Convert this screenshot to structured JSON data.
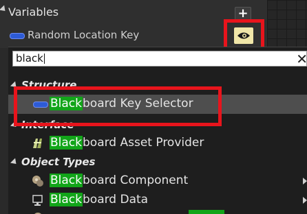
{
  "variables": {
    "title": "Variables",
    "add_label": "+",
    "variable_name": "Random Location Key"
  },
  "picker": {
    "search_value": "black",
    "categories": [
      {
        "label": "Structure"
      },
      {
        "label": "Interface"
      },
      {
        "label": "Object Types"
      }
    ],
    "items": [
      {
        "match": "Black",
        "rest": "board Key Selector",
        "category": "Structure",
        "selected": true
      },
      {
        "match": "Black",
        "rest": "board Asset Provider",
        "category": "Interface"
      },
      {
        "match": "Black",
        "rest": "board Component",
        "category": "Object Types"
      },
      {
        "match": "Black",
        "rest": "board Data",
        "category": "Object Types"
      }
    ]
  },
  "colors": {
    "highlight": "#12a519",
    "annotation_box": "#e8141c",
    "struct_pill": "#2d5bd6"
  }
}
